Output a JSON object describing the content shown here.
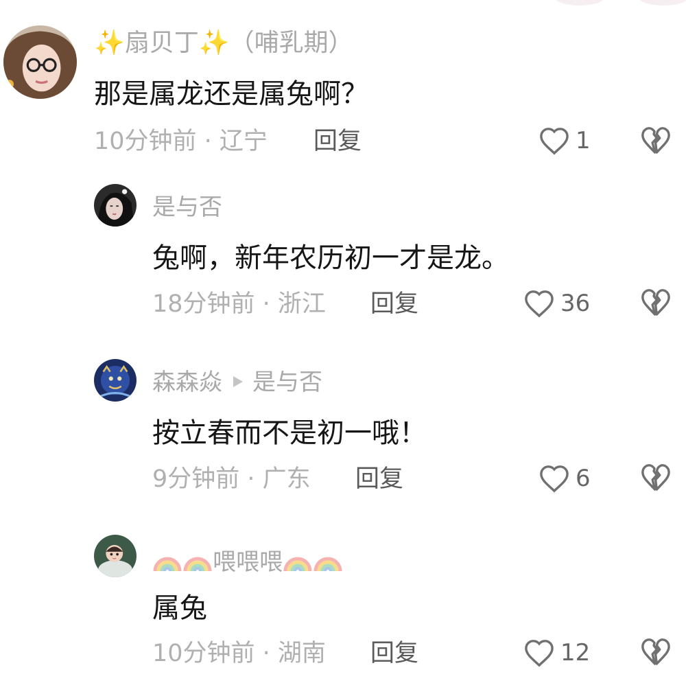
{
  "comments": [
    {
      "username": "扇贝丁",
      "sparkle_left": "✨",
      "sparkle_right": "✨",
      "badge": "（哺乳期）",
      "text": "那是属龙还是属兔啊？",
      "time_location": "10分钟前 · 辽宁",
      "reply_label": "回复",
      "likes": "1"
    },
    {
      "username": "是与否",
      "text": "兔啊，新年农历初一才是龙。",
      "time_location": "18分钟前 · 浙江",
      "reply_label": "回复",
      "likes": "36"
    },
    {
      "username": "森森焱",
      "reply_to": "是与否",
      "text": "按立春而不是初一哦！",
      "time_location": "9分钟前 · 广东",
      "reply_label": "回复",
      "likes": "6"
    },
    {
      "username": "喂喂喂",
      "username_decor_icon": "rainbow-icon",
      "text": "属兔",
      "time_location": "10分钟前 · 湖南",
      "reply_label": "回复",
      "likes": "12"
    }
  ],
  "icons": {
    "like": "heart-outline-icon",
    "dislike": "broken-heart-icon"
  },
  "colors": {
    "username": "#a9a9a9",
    "comment_text": "#161616",
    "meta": "#b0b0b0",
    "icon_stroke": "#707070"
  }
}
